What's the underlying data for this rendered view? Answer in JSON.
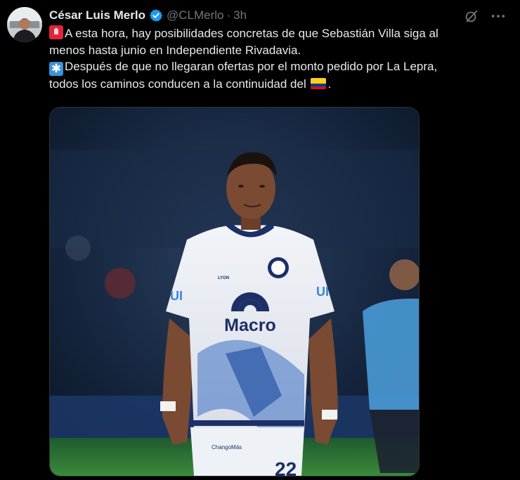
{
  "tweet": {
    "author_name": "César Luis Merlo",
    "handle": "@CLMerlo",
    "separator": "·",
    "time": "3h",
    "text_line1": "A esta hora, hay posibilidades concretas de que Sebastián Villa siga al",
    "text_line2": "menos hasta junio en Independiente Rivadavia.",
    "text_line3": "Después de que no llegaran ofertas por el monto pedido por La Lepra,",
    "text_line4_a": "todos los caminos conducen a la continuidad del",
    "text_line4_b": ".",
    "emoji_1": "rotating-light-icon",
    "emoji_2": "asterisk-icon",
    "flag": "colombia-flag-icon"
  },
  "photo": {
    "sponsor": "Macro",
    "kit_brand": "LYON",
    "chest_sponsor_left": "UI",
    "chest_sponsor_right": "UI",
    "shorts_sponsor": "ChangoMás",
    "number": "22"
  },
  "colors": {
    "background": "#000000",
    "text": "#e7e9ea",
    "muted": "#71767b",
    "verified": "#1d9bf0"
  }
}
